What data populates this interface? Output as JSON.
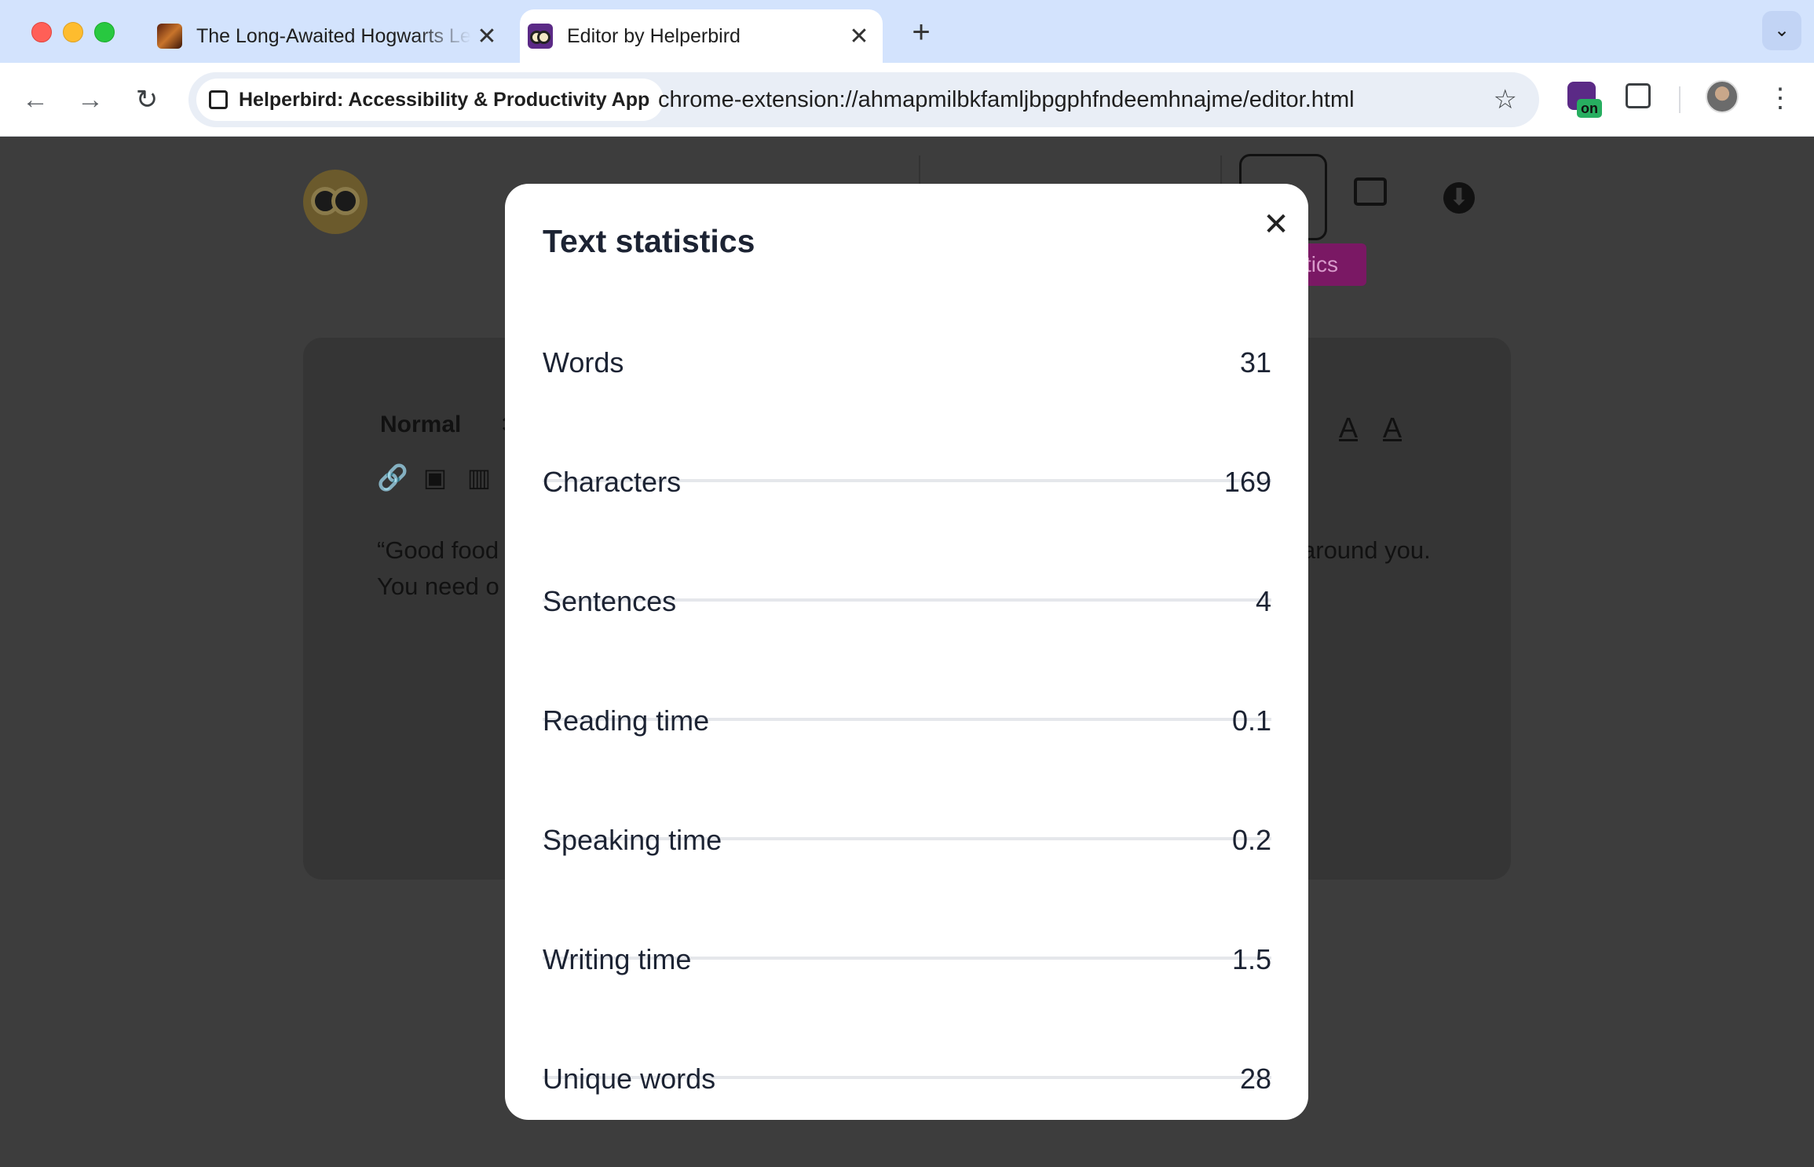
{
  "browser": {
    "tabs": [
      {
        "title": "The Long-Awaited Hogwarts Legacy",
        "favicon": "hogwarts-favicon",
        "active": false
      },
      {
        "title": "Editor by Helperbird",
        "favicon": "helperbird-owl-favicon",
        "active": true
      }
    ],
    "tab_close_glyph": "✕",
    "new_tab_glyph": "+",
    "tab_menu_glyph": "⌄",
    "site_chip_label": "Helperbird: Accessibility & Productivity App",
    "url": "chrome-extension://ahmapmilbkfamljbpgphfndeemhnajme/editor.html",
    "extension_badge": "on",
    "nav": {
      "back": "←",
      "forward": "→",
      "reload": "↻",
      "bookmark": "☆",
      "menu": "⋮"
    }
  },
  "editor": {
    "block_format": "Normal",
    "tooltip_fragment": "stics",
    "text_left_line1": "“Good food",
    "text_left_line2": "You need o",
    "text_right_line1": "around you."
  },
  "modal": {
    "title": "Text statistics",
    "close_glyph": "✕",
    "stats": [
      {
        "label": "Words",
        "value": "31"
      },
      {
        "label": "Characters",
        "value": "169"
      },
      {
        "label": "Sentences",
        "value": "4"
      },
      {
        "label": "Reading time",
        "value": "0.1"
      },
      {
        "label": "Speaking time",
        "value": "0.2"
      },
      {
        "label": "Writing time",
        "value": "1.5"
      },
      {
        "label": "Unique words",
        "value": "28"
      }
    ]
  },
  "colors": {
    "tab_strip": "#d3e3fd",
    "overlay_background": "#3d3d3d",
    "modal_background": "#ffffff",
    "tooltip_accent": "#7a1864",
    "extension_badge": "#27ae60"
  }
}
